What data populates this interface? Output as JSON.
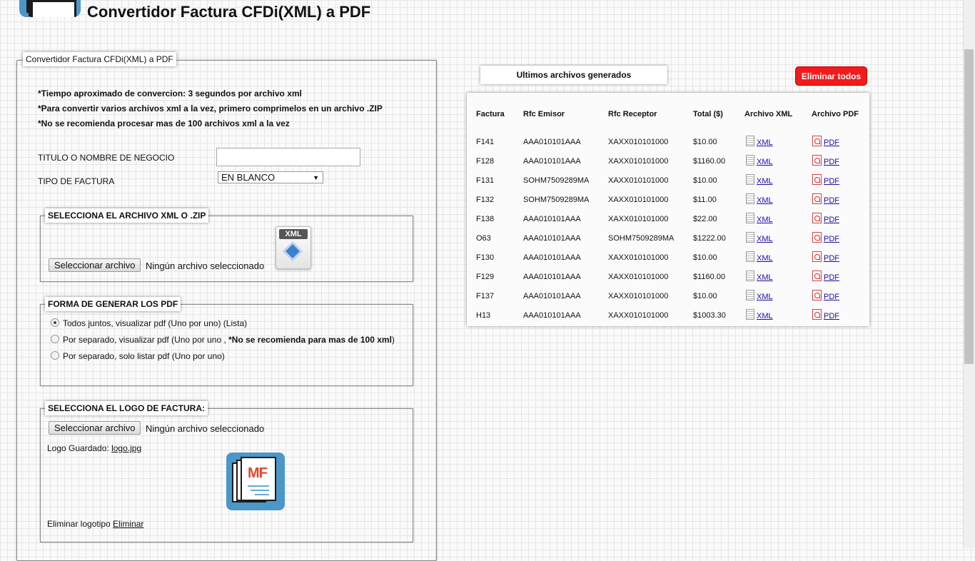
{
  "header": {
    "title": "Convertidor Factura CFDi(XML) a PDF"
  },
  "form": {
    "legend": "Convertidor Factura CFDi(XML) a PDF",
    "notes": [
      "*Tiempo aproximado de convercion: 3 segundos por archivo xml",
      "*Para convertir varios archivos xml a la vez, primero comprimelos en un archivo .ZIP",
      "*No se recomienda procesar mas de 100 archivos xml a la vez"
    ],
    "title_label": "TITULO O NOMBRE DE NEGOCIO",
    "title_value": "",
    "tipo_label": "TIPO DE FACTURA",
    "tipo_selected": "EN BLANCO",
    "xml_section": {
      "legend": "SELECCIONA EL ARCHIVO XML O .ZIP",
      "button": "Seleccionar archivo",
      "status": "Ningún archivo seleccionado",
      "icon_badge": "XML"
    },
    "mode_section": {
      "legend": "FORMA DE GENERAR LOS PDF",
      "options": [
        {
          "label": "Todos juntos, visualizar pdf (Uno por uno) (Lista)",
          "bold": "",
          "suffix": "",
          "checked": true
        },
        {
          "label": "Por separado, visualizar pdf (Uno por uno , ",
          "bold": "*No se recomienda para mas de 100 xml",
          "suffix": ")",
          "checked": false
        },
        {
          "label": "Por separado, solo listar pdf (Uno por uno)",
          "bold": "",
          "suffix": "",
          "checked": false
        }
      ]
    },
    "logo_section": {
      "legend": "SELECCIONA EL LOGO DE FACTURA:",
      "button": "Seleccionar archivo",
      "status": "Ningún archivo seleccionado",
      "saved_label": "Logo Guardado: ",
      "saved_file": "logo.jpg",
      "logo_text": "MF",
      "delete_label": "Eliminar logotipo ",
      "delete_link": "Eliminar"
    }
  },
  "results": {
    "header": "Ultimos archivos generados",
    "delete_all": "Eliminar todos",
    "columns": [
      "Factura",
      "Rfc Emisor",
      "Rfc Receptor",
      "Total ($)",
      "Archivo XML",
      "Archivo PDF"
    ],
    "xml_link": "XML",
    "pdf_link": "PDF",
    "rows": [
      {
        "factura": "F141",
        "emisor": "AAA010101AAA",
        "receptor": "XAXX010101000",
        "total": "$10.00"
      },
      {
        "factura": "F128",
        "emisor": "AAA010101AAA",
        "receptor": "XAXX010101000",
        "total": "$1160.00"
      },
      {
        "factura": "F131",
        "emisor": "SOHM7509289MA",
        "receptor": "XAXX010101000",
        "total": "$10.00"
      },
      {
        "factura": "F132",
        "emisor": "SOHM7509289MA",
        "receptor": "XAXX010101000",
        "total": "$11.00"
      },
      {
        "factura": "F138",
        "emisor": "AAA010101AAA",
        "receptor": "XAXX010101000",
        "total": "$22.00"
      },
      {
        "factura": "O63",
        "emisor": "AAA010101AAA",
        "receptor": "SOHM7509289MA",
        "total": "$1222.00"
      },
      {
        "factura": "F130",
        "emisor": "AAA010101AAA",
        "receptor": "XAXX010101000",
        "total": "$10.00"
      },
      {
        "factura": "F129",
        "emisor": "AAA010101AAA",
        "receptor": "XAXX010101000",
        "total": "$1160.00"
      },
      {
        "factura": "F137",
        "emisor": "AAA010101AAA",
        "receptor": "XAXX010101000",
        "total": "$10.00"
      },
      {
        "factura": "H13",
        "emisor": "AAA010101AAA",
        "receptor": "XAXX010101000",
        "total": "$1003.30"
      }
    ]
  },
  "colors": {
    "danger": "#f21b1b",
    "brand_blue": "#4a97c8",
    "link": "#1a0dab"
  }
}
